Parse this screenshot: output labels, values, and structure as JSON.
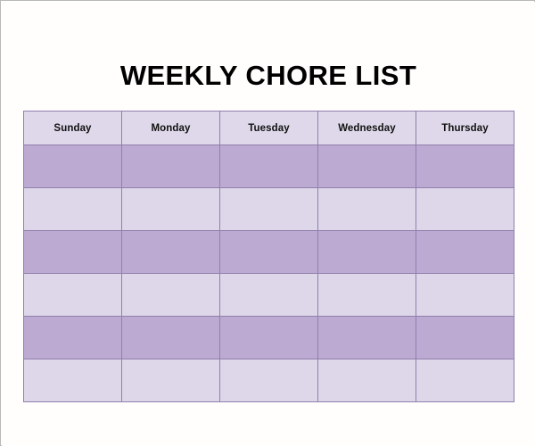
{
  "document": {
    "title": "WEEKLY CHORE LIST",
    "frame_border_color": "#b9b9b9",
    "background_color": "#fffefc"
  },
  "table": {
    "border_color": "#8f80ac",
    "header_background": "#dfd8ea",
    "row_dark_background": "#bcaad3",
    "row_light_background": "#ded7e9",
    "columns": [
      {
        "label": "Sunday"
      },
      {
        "label": "Monday"
      },
      {
        "label": "Tuesday"
      },
      {
        "label": "Wednesday"
      },
      {
        "label": "Thursday"
      }
    ],
    "rows": [
      {
        "style": "dark",
        "cells": [
          "",
          "",
          "",
          "",
          ""
        ]
      },
      {
        "style": "light",
        "cells": [
          "",
          "",
          "",
          "",
          ""
        ]
      },
      {
        "style": "dark",
        "cells": [
          "",
          "",
          "",
          "",
          ""
        ]
      },
      {
        "style": "light",
        "cells": [
          "",
          "",
          "",
          "",
          ""
        ]
      },
      {
        "style": "dark",
        "cells": [
          "",
          "",
          "",
          "",
          ""
        ]
      },
      {
        "style": "light",
        "cells": [
          "",
          "",
          "",
          "",
          ""
        ]
      }
    ]
  }
}
